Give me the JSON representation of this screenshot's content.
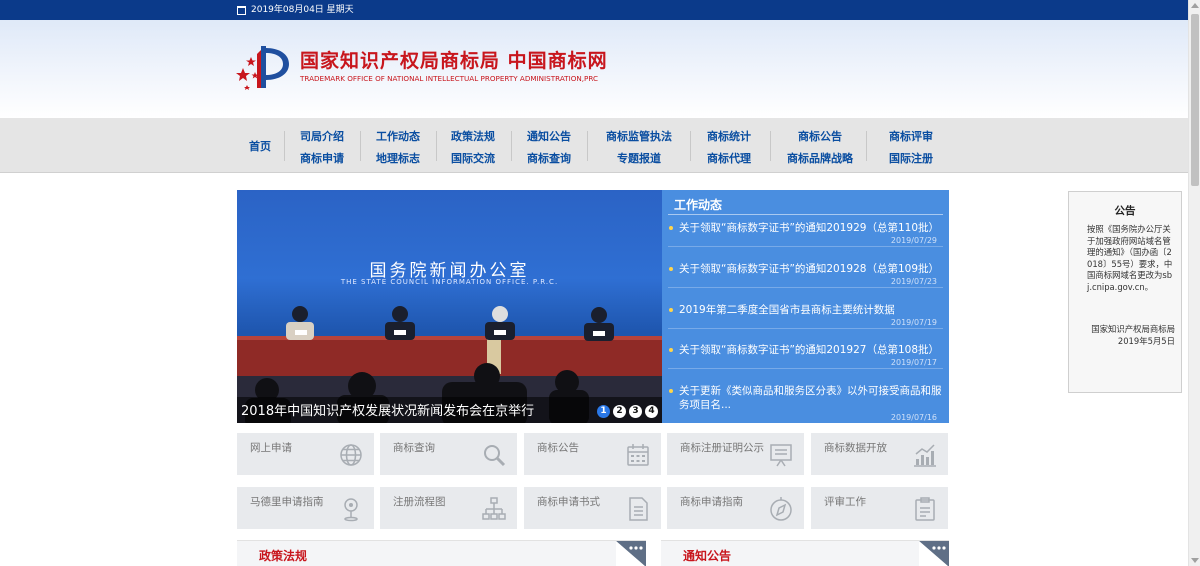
{
  "topbar": {
    "date": "2019年08月04日 星期天"
  },
  "header": {
    "title": "国家知识产权局商标局 中国商标网",
    "subtitle": "TRADEMARK OFFICE OF NATIONAL INTELLECTUAL PROPERTY ADMINISTRATION,PRC"
  },
  "nav": {
    "home": "首页",
    "columns": [
      {
        "top": "司局介绍",
        "bottom": "商标申请"
      },
      {
        "top": "工作动态",
        "bottom": "地理标志"
      },
      {
        "top": "政策法规",
        "bottom": "国际交流"
      },
      {
        "top": "通知公告",
        "bottom": "商标查询"
      },
      {
        "top": "商标监管执法",
        "bottom": "专题报道"
      },
      {
        "top": "商标统计",
        "bottom": "商标代理"
      },
      {
        "top": "商标公告",
        "bottom": "商标品牌战略"
      },
      {
        "top": "商标评审",
        "bottom": "国际注册"
      }
    ]
  },
  "slider": {
    "backdrop_title": "国务院新闻办公室",
    "backdrop_subtitle": "THE STATE COUNCIL INFORMATION OFFICE. P.R.C.",
    "caption": "2018年中国知识产权发展状况新闻发布会在京举行",
    "dots": [
      "1",
      "2",
      "3",
      "4"
    ],
    "active_dot": 0
  },
  "news": {
    "heading": "工作动态",
    "items": [
      {
        "title": "关于领取“商标数字证书”的通知201929（总第110批）",
        "date": "2019/07/29"
      },
      {
        "title": "关于领取“商标数字证书”的通知201928（总第109批）",
        "date": "2019/07/23"
      },
      {
        "title": "2019年第二季度全国省市县商标主要统计数据",
        "date": "2019/07/19"
      },
      {
        "title": "关于领取“商标数字证书”的通知201927（总第108批）",
        "date": "2019/07/17"
      },
      {
        "title": "关于更新《类似商品和服务区分表》以外可接受商品和服务项目名...",
        "date": "2019/07/16"
      }
    ]
  },
  "tiles": [
    {
      "label": "网上申请",
      "icon": "globe-icon"
    },
    {
      "label": "商标查询",
      "icon": "magnifier-icon"
    },
    {
      "label": "商标公告",
      "icon": "calendar-icon"
    },
    {
      "label": "商标注册证明公示",
      "icon": "board-icon"
    },
    {
      "label": "商标数据开放",
      "icon": "chart-icon"
    },
    {
      "label": "马德里申请指南",
      "icon": "pin-icon"
    },
    {
      "label": "注册流程图",
      "icon": "flow-icon"
    },
    {
      "label": "商标申请书式",
      "icon": "document-icon"
    },
    {
      "label": "商标申请指南",
      "icon": "compass-icon"
    },
    {
      "label": "评审工作",
      "icon": "clipboard-icon"
    }
  ],
  "sections": [
    {
      "title": "政策法规"
    },
    {
      "title": "通知公告"
    }
  ],
  "notice": {
    "title": "公告",
    "body": "按照《国务院办公厅关于加强政府网站域名管理的通知》（国办函〔2018〕55号）要求，中国商标网域名更改为sbj.cnipa.gov.cn。",
    "signature": "国家知识产权局商标局",
    "date": "2019年5月5日"
  },
  "colors": {
    "topbar": "#0b3a8a",
    "brand_red": "#c8161d",
    "nav_text": "#0a4ea1",
    "news_panel": "#4a8ee0",
    "tile_bg": "#e8eaed"
  }
}
